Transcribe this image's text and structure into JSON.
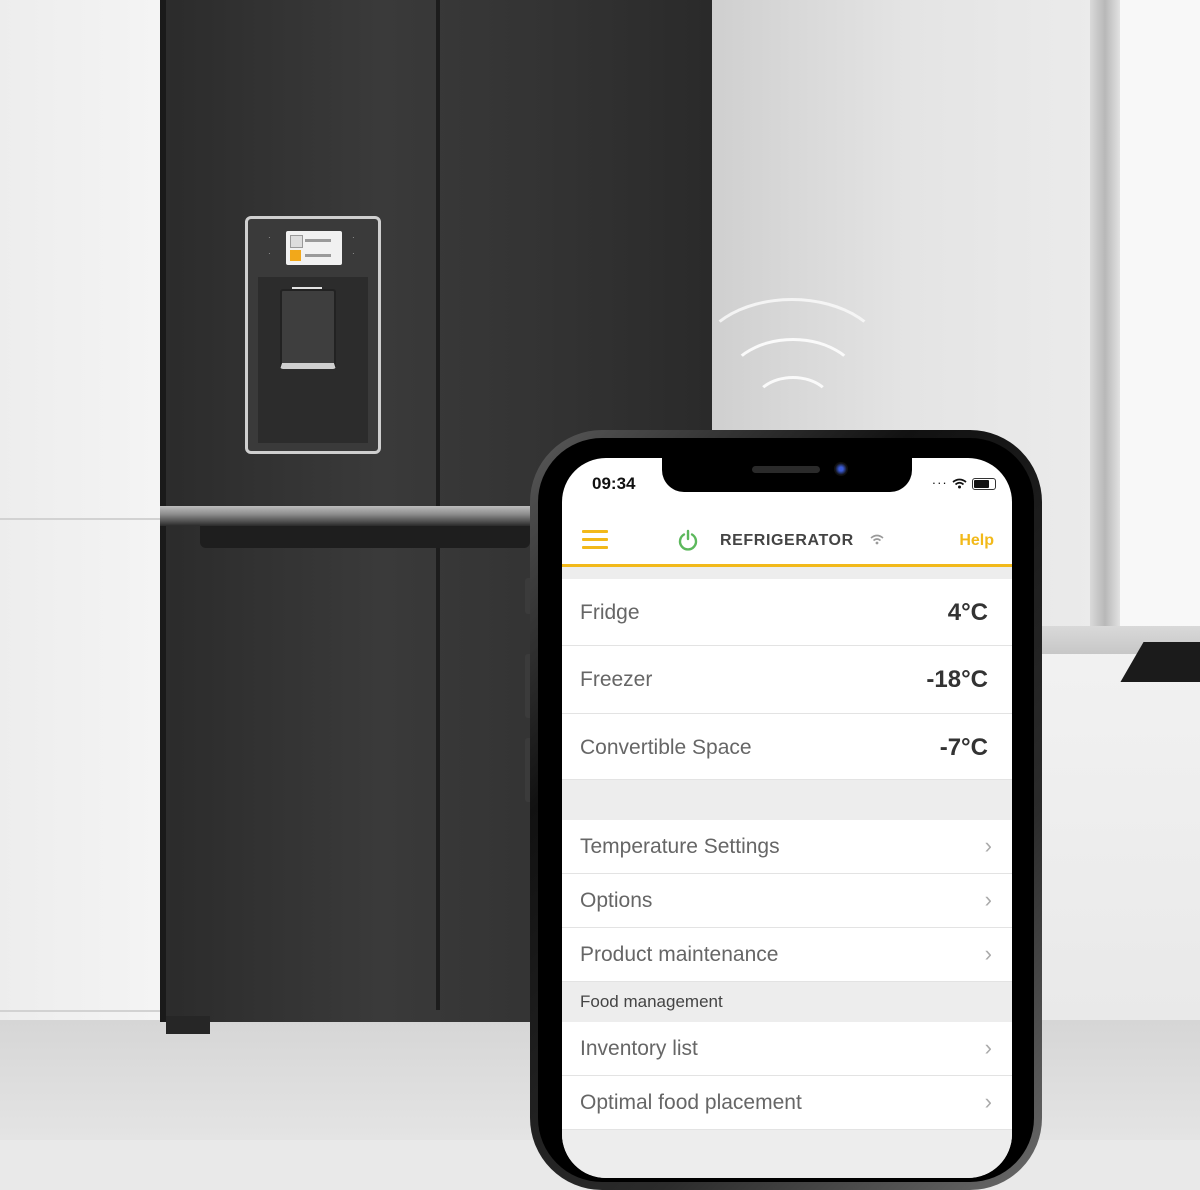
{
  "status_bar": {
    "time": "09:34"
  },
  "header": {
    "title": "REFRIGERATOR",
    "help_label": "Help",
    "accent_color": "#f2b91a"
  },
  "compartments": [
    {
      "label": "Fridge",
      "value": "4°C"
    },
    {
      "label": "Freezer",
      "value": "-18°C"
    },
    {
      "label": "Convertible Space",
      "value": "-7°C"
    }
  ],
  "menu_items": [
    {
      "label": "Temperature Settings"
    },
    {
      "label": "Options"
    },
    {
      "label": "Product maintenance"
    }
  ],
  "food_section": {
    "title": "Food management",
    "items": [
      {
        "label": "Inventory list"
      },
      {
        "label": "Optimal food placement"
      }
    ]
  },
  "icons": {
    "menu": "hamburger-icon",
    "power": "power-icon",
    "wifi": "wifi-icon",
    "chevron": "chevron-right-icon",
    "battery": "battery-icon"
  }
}
